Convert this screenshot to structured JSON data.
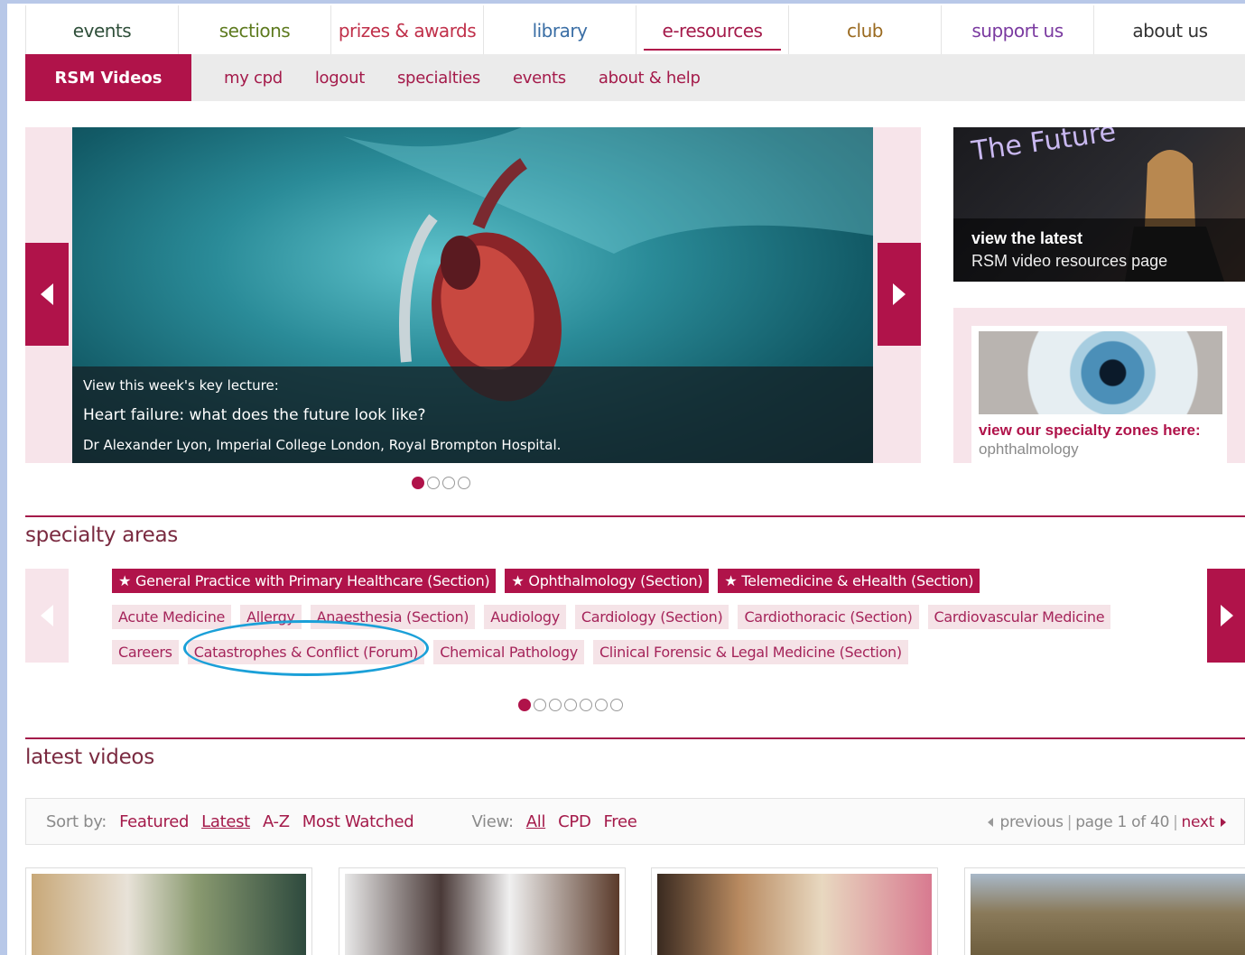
{
  "topnav": {
    "tabs": [
      {
        "label": "events",
        "color": "#2f4f3a"
      },
      {
        "label": "sections",
        "color": "#5d7a1e"
      },
      {
        "label": "prizes & awards",
        "color": "#c0304a"
      },
      {
        "label": "library",
        "color": "#3a6ea5"
      },
      {
        "label": "e-resources",
        "color": "#a41a4a",
        "active": true
      },
      {
        "label": "club",
        "color": "#9a6a20"
      },
      {
        "label": "support us",
        "color": "#7a3aa0"
      },
      {
        "label": "about us",
        "color": "#333333"
      }
    ]
  },
  "subnav": {
    "brand": "RSM Videos",
    "links": [
      "my cpd",
      "logout",
      "specialties",
      "events",
      "about & help"
    ]
  },
  "hero": {
    "line1": "View this week's key lecture:",
    "line2": "Heart failure: what does the future look like?",
    "line3": "Dr Alexander Lyon, Imperial College London, Royal Brompton Hospital."
  },
  "future": {
    "title": "The Future",
    "caption_bold": "view the latest",
    "caption": "RSM video resources page"
  },
  "zone": {
    "title": "view our specialty zones here:",
    "subtitle": "ophthalmology"
  },
  "specialty": {
    "heading": "specialty areas",
    "featured": [
      "General Practice with Primary Healthcare (Section)",
      "Ophthalmology (Section)",
      "Telemedicine & eHealth (Section)"
    ],
    "row2": [
      "Acute Medicine",
      "Allergy",
      "Anaesthesia (Section)",
      "Audiology",
      "Cardiology (Section)",
      "Cardiothoracic (Section)",
      "Cardiovascular Medicine"
    ],
    "row3": [
      "Careers",
      "Catastrophes & Conflict (Forum)",
      "Chemical Pathology",
      "Clinical Forensic & Legal Medicine (Section)"
    ]
  },
  "latest": {
    "heading": "latest videos",
    "sort_label": "Sort by:",
    "sort_options": [
      "Featured",
      "Latest",
      "A-Z",
      "Most Watched"
    ],
    "view_label": "View:",
    "view_options": [
      "All",
      "CPD",
      "Free"
    ],
    "pager": {
      "previous": "previous",
      "page": "page 1 of 40",
      "next": "next"
    }
  },
  "colors": {
    "brand": "#b0134a",
    "tag_bg": "#f5e3e7",
    "highlight": "#1ba0d8"
  }
}
